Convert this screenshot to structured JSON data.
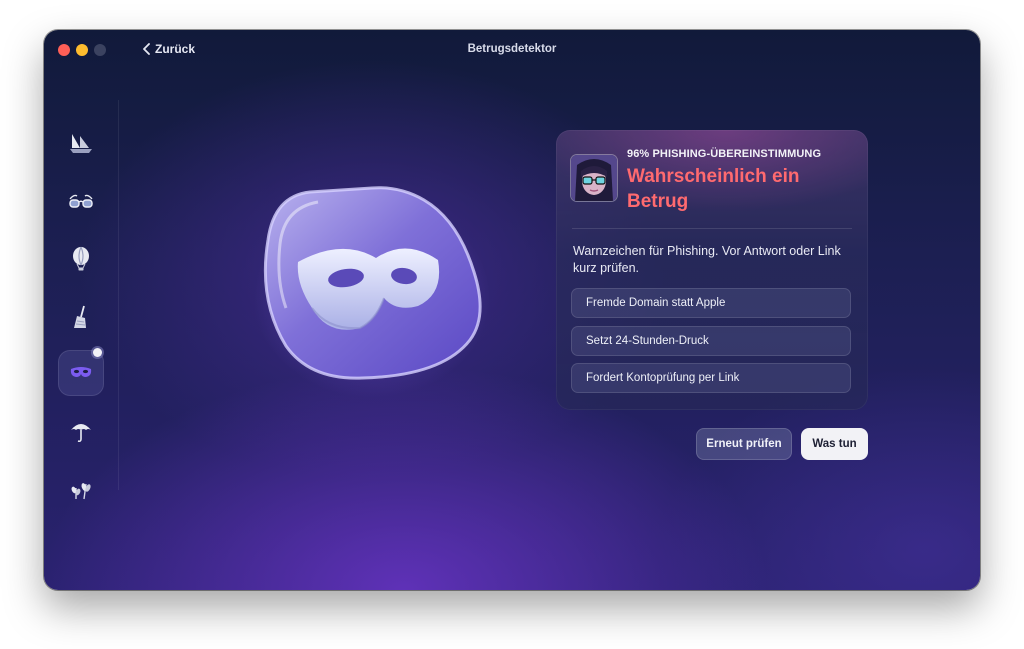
{
  "window": {
    "title": "Betrugsdetektor",
    "back_label": "Zurück"
  },
  "sidebar": {
    "items": [
      {
        "icon": "sailboat-icon"
      },
      {
        "icon": "glasses-icon"
      },
      {
        "icon": "hot-air-balloon-icon"
      },
      {
        "icon": "broom-icon"
      },
      {
        "icon": "mask-icon",
        "active": true
      },
      {
        "icon": "umbrella-icon"
      },
      {
        "icon": "plants-icon"
      }
    ]
  },
  "hero": {
    "icon": "mask-icon"
  },
  "result": {
    "match_label": "96% PHISHING-ÜBEREINSTIMMUNG",
    "verdict": "Wahrscheinlich ein Betrug",
    "description": "Warnzeichen für Phishing. Vor Antwort oder Link kurz prüfen.",
    "flags": [
      "Fremde Domain statt Apple",
      "Setzt 24-Stunden-Druck",
      "Fordert Kontoprüfung per Link"
    ]
  },
  "actions": {
    "recheck_label": "Erneut prüfen",
    "what_to_do_label": "Was tun"
  },
  "colors": {
    "verdict": "#ff6a6f",
    "accent": "#7b5cf0"
  }
}
